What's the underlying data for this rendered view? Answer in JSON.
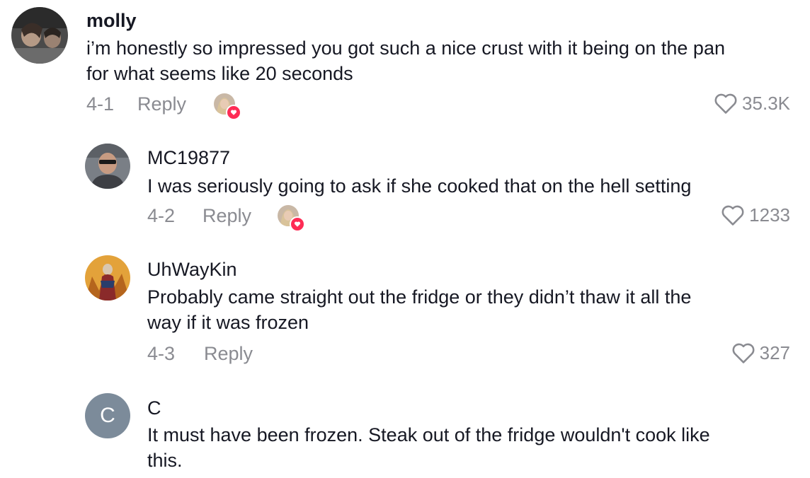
{
  "comments": [
    {
      "username": "molly",
      "text_lines": [
        "i’m honestly so impressed you got such a nice crust with it being on the pan",
        "for what seems like 20 seconds"
      ],
      "date": "4-1",
      "reply_label": "Reply",
      "like_count": "35.3K",
      "liked_by_creator": true,
      "avatar_icon": "photo-avatar"
    },
    {
      "username": "MC19877",
      "text_lines": [
        "I was seriously going to ask if she cooked that on the hell setting"
      ],
      "date": "4-2",
      "reply_label": "Reply",
      "like_count": "1233",
      "liked_by_creator": true,
      "avatar_icon": "photo-avatar"
    },
    {
      "username": "UhWayKin",
      "text_lines": [
        "Probably came straight out the fridge or they didn’t thaw it all the",
        "way if it was frozen"
      ],
      "date": "4-3",
      "reply_label": "Reply",
      "like_count": "327",
      "liked_by_creator": false,
      "avatar_icon": "photo-avatar"
    },
    {
      "username": "C",
      "avatar_initial": "C",
      "text_lines": [
        "It must have been frozen. Steak out of the fridge wouldn't cook like",
        "this."
      ]
    }
  ],
  "colors": {
    "text": "#161823",
    "secondary": "#8a8b91",
    "heart_badge": "#fe2c55",
    "initial_avatar_bg": "#7c8b9a"
  }
}
